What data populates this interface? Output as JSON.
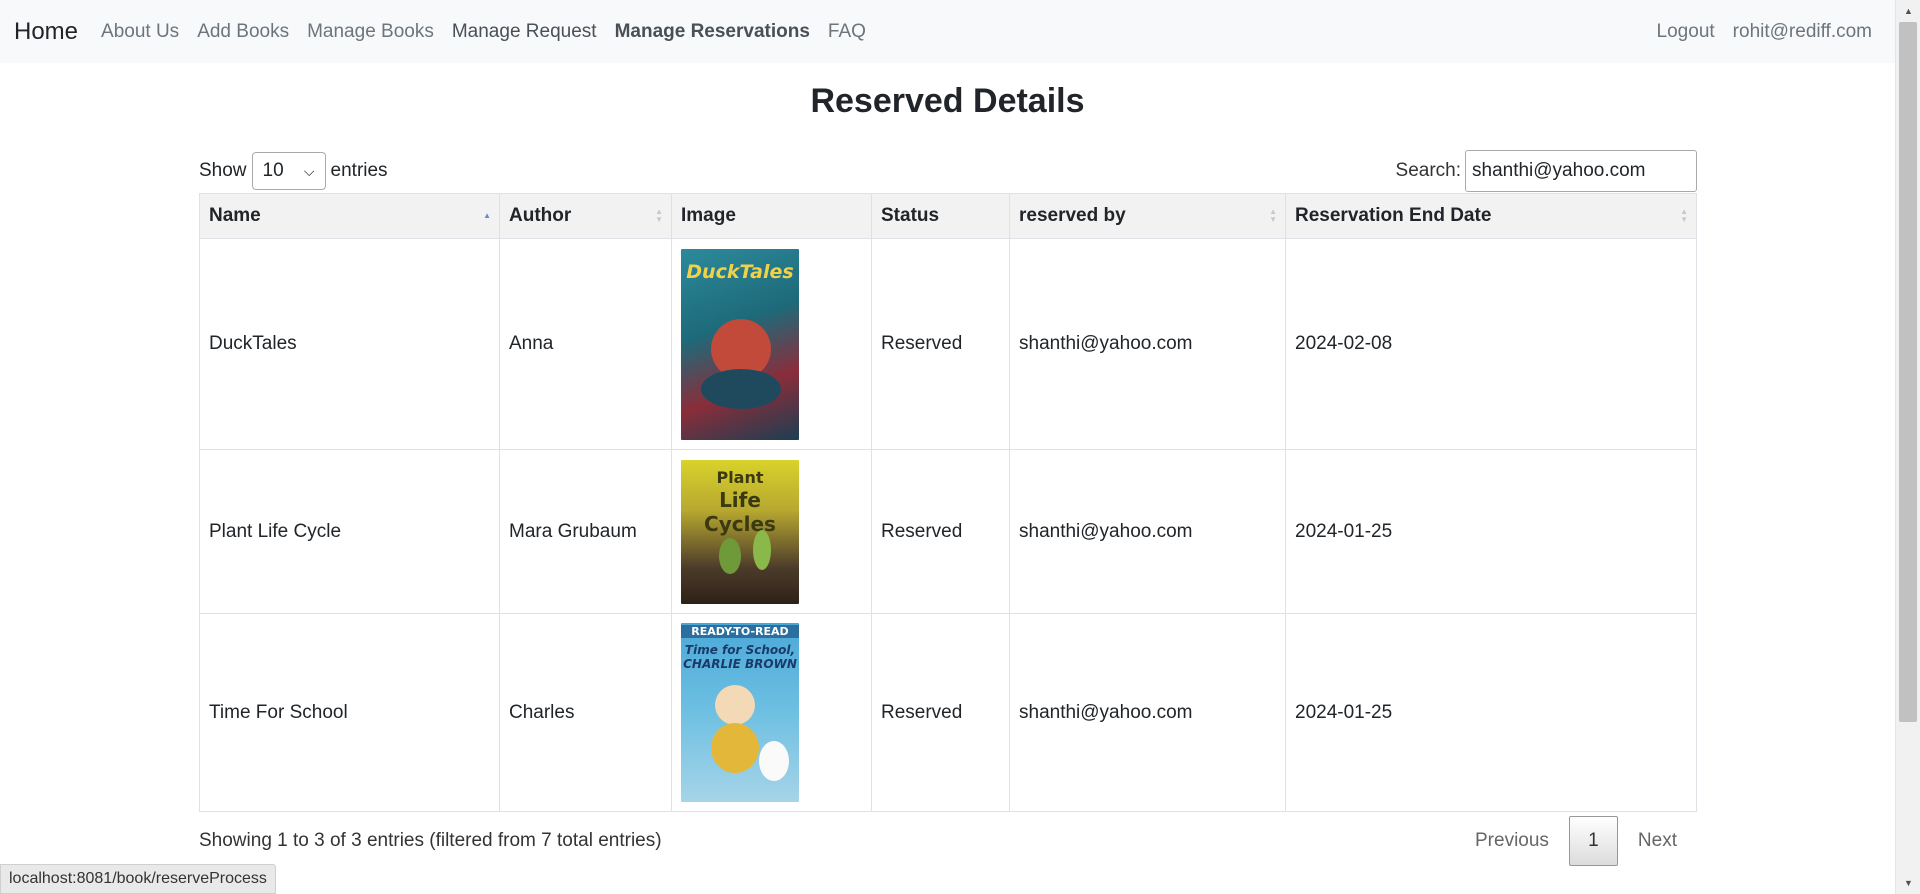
{
  "nav": {
    "brand": "Home",
    "links": [
      "About Us",
      "Add Books",
      "Manage Books",
      "Manage Request",
      "Manage Reservations",
      "FAQ"
    ],
    "right": [
      "Logout",
      "rohit@rediff.com"
    ]
  },
  "page": {
    "title": "Reserved Details",
    "length": {
      "show": "Show",
      "value": "10",
      "entries": "entries"
    },
    "search": {
      "label": "Search:",
      "value": "shanthi@yahoo.com"
    }
  },
  "table": {
    "columns": [
      "Name",
      "Author",
      "Image",
      "Status",
      "reserved by",
      "Reservation End Date"
    ],
    "rows": [
      {
        "name": "DuckTales",
        "author": "Anna",
        "image": "DuckTales cover",
        "cover_text": "DuckTales",
        "status": "Reserved",
        "reserved_by": "shanthi@yahoo.com",
        "end_date": "2024-02-08"
      },
      {
        "name": "Plant Life Cycle",
        "author": "Mara Grubaum",
        "image": "Plant Life Cycles cover",
        "cover_text": [
          "Plant",
          "Life Cycles"
        ],
        "status": "Reserved",
        "reserved_by": "shanthi@yahoo.com",
        "end_date": "2024-01-25"
      },
      {
        "name": "Time For School",
        "author": "Charles",
        "image": "Time for School, Charlie Brown cover",
        "cover_text": [
          "READY-TO-READ",
          "Time for School, CHARLIE BROWN"
        ],
        "status": "Reserved",
        "reserved_by": "shanthi@yahoo.com",
        "end_date": "2024-01-25"
      }
    ]
  },
  "footer": {
    "info": "Showing 1 to 3 of 3 entries (filtered from 7 total entries)",
    "previous": "Previous",
    "current_page": "1",
    "next": "Next"
  },
  "status_bar": "localhost:8081/book/reserveProcess"
}
